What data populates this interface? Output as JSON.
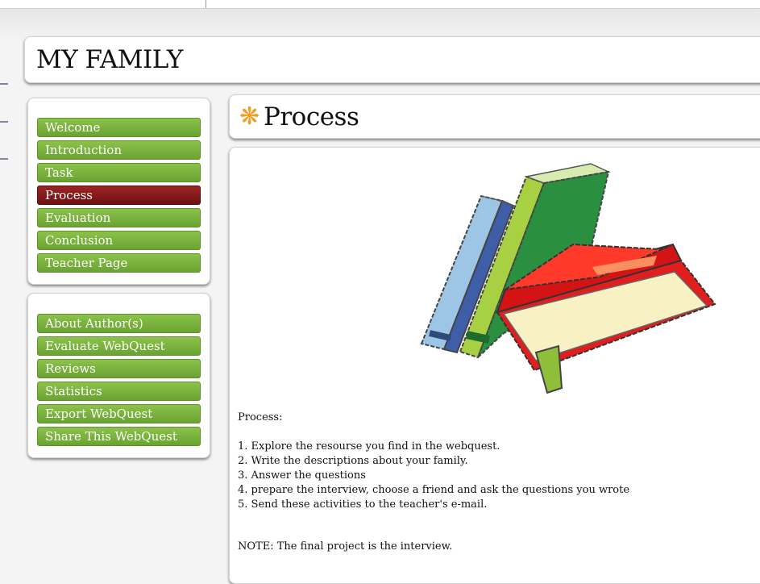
{
  "site": {
    "title": "MY FAMILY"
  },
  "nav_primary": [
    {
      "label": "Welcome",
      "active": false
    },
    {
      "label": "Introduction",
      "active": false
    },
    {
      "label": "Task",
      "active": false
    },
    {
      "label": "Process",
      "active": true
    },
    {
      "label": "Evaluation",
      "active": false
    },
    {
      "label": "Conclusion",
      "active": false
    },
    {
      "label": "Teacher Page",
      "active": false
    }
  ],
  "nav_secondary": [
    {
      "label": "About Author(s)"
    },
    {
      "label": "Evaluate WebQuest"
    },
    {
      "label": "Reviews"
    },
    {
      "label": "Statistics"
    },
    {
      "label": "Export WebQuest"
    },
    {
      "label": "Share This WebQuest"
    }
  ],
  "section": {
    "title": "Process",
    "icon": "asterisk-icon",
    "illustration": "books-illustration"
  },
  "content": {
    "intro": "Process:",
    "steps": [
      "1.  Explore the resourse you find in the webquest.",
      "2. Write the descriptions about your family.",
      "3. Answer the questions",
      "4. prepare the interview, choose a friend and ask the questions you wrote",
      "5. Send these activities to the teacher's  e-mail."
    ],
    "note": "NOTE: The final project is the interview."
  },
  "colors": {
    "nav_green": "#7bb33d",
    "nav_active": "#8b1a1a",
    "accent_asterisk": "#f29b1d"
  }
}
